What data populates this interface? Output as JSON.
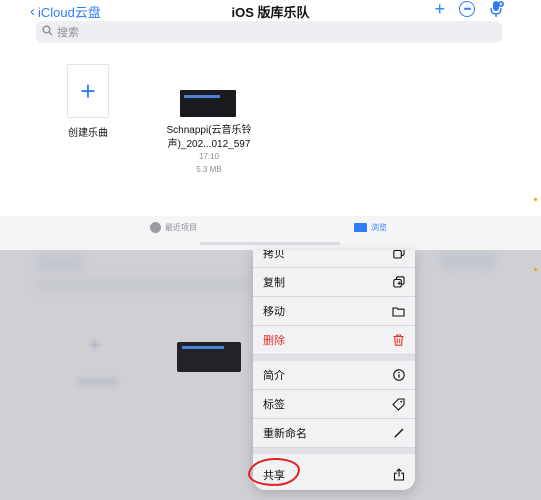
{
  "nav": {
    "back_label": "iCloud云盘",
    "title": "iOS 版库乐队"
  },
  "search": {
    "placeholder": "搜索"
  },
  "files": {
    "new_song_label": "创建乐曲",
    "file_name": "Schnappi(云音乐铃声)_202...012_597",
    "file_time": "17:10",
    "file_size": "5.3 MB"
  },
  "tabs": {
    "recent": "最近项目",
    "browse": "浏览"
  },
  "context_menu": {
    "items": [
      {
        "label": "拷贝",
        "icon": "copy-icon"
      },
      {
        "label": "复制",
        "icon": "duplicate-icon"
      },
      {
        "label": "移动",
        "icon": "folder-icon"
      },
      {
        "label": "删除",
        "icon": "trash-icon"
      },
      {
        "label": "简介",
        "icon": "info-icon"
      },
      {
        "label": "标签",
        "icon": "tag-icon"
      },
      {
        "label": "重新命名",
        "icon": "pencil-icon"
      },
      {
        "label": "共享",
        "icon": "share-icon"
      }
    ]
  },
  "colors": {
    "accent": "#2f7cf6",
    "destructive": "#e5322b",
    "annotation": "#e22020"
  }
}
